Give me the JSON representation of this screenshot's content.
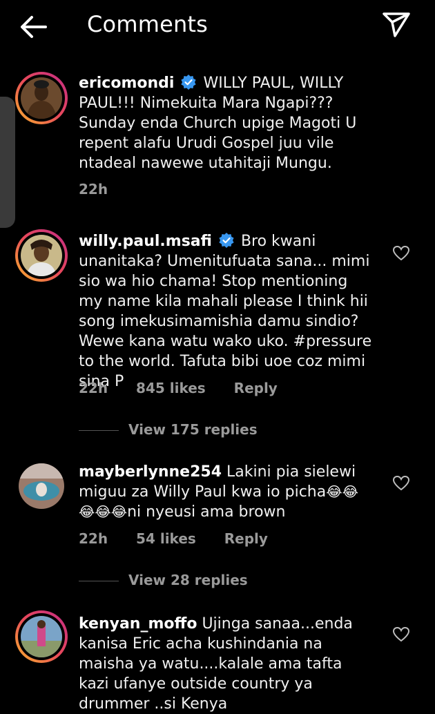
{
  "header": {
    "title": "Comments",
    "back_icon": "arrow-left-icon",
    "share_icon": "send-icon"
  },
  "comments": [
    {
      "username": "ericomondi",
      "verified": true,
      "text": "WILLY PAUL, WILLY PAUL!!! Nimekuita Mara Ngapi??? Sunday enda Church upige Magoti U repent alafu Urudi Gospel juu vile ntadeal nawewe utahitaji Mungu.",
      "time": "22h",
      "likes": "",
      "reply": ""
    },
    {
      "username": "willy.paul.msafi",
      "verified": true,
      "text": "Bro kwani unanitaka? Umenitufuata sana... mimi sio wa hio chama! Stop mentioning my name kila mahali please I think hii song imekusimamishia damu sindio? Wewe kana watu wako uko. #pressure to the world. Tafuta bibi uoe coz mimi sina P",
      "time": "22h",
      "likes": "845 likes",
      "reply": "Reply",
      "view_replies": "View 175 replies"
    },
    {
      "username": "mayberlynne254",
      "verified": false,
      "text_part1": "Lakini pia sielewi miguu za Willy Paul kwa io picha",
      "emoji1": "😂😂",
      "emoji2": "😂😂😂",
      "text_part2": "ni nyeusi ama brown",
      "time": "22h",
      "likes": "54 likes",
      "reply": "Reply",
      "view_replies": "View 28 replies"
    },
    {
      "username": "kenyan_moffo",
      "verified": false,
      "text": "Ujinga sanaa...enda kanisa Eric acha kushindania na maisha ya watu....kalale ama tafta kazi ufanye outside country ya drummer ..si Kenya"
    }
  ],
  "colors": {
    "background": "#000000",
    "text": "#f0f0f0",
    "muted": "#9a9a9a",
    "verified": "#3897f0"
  }
}
